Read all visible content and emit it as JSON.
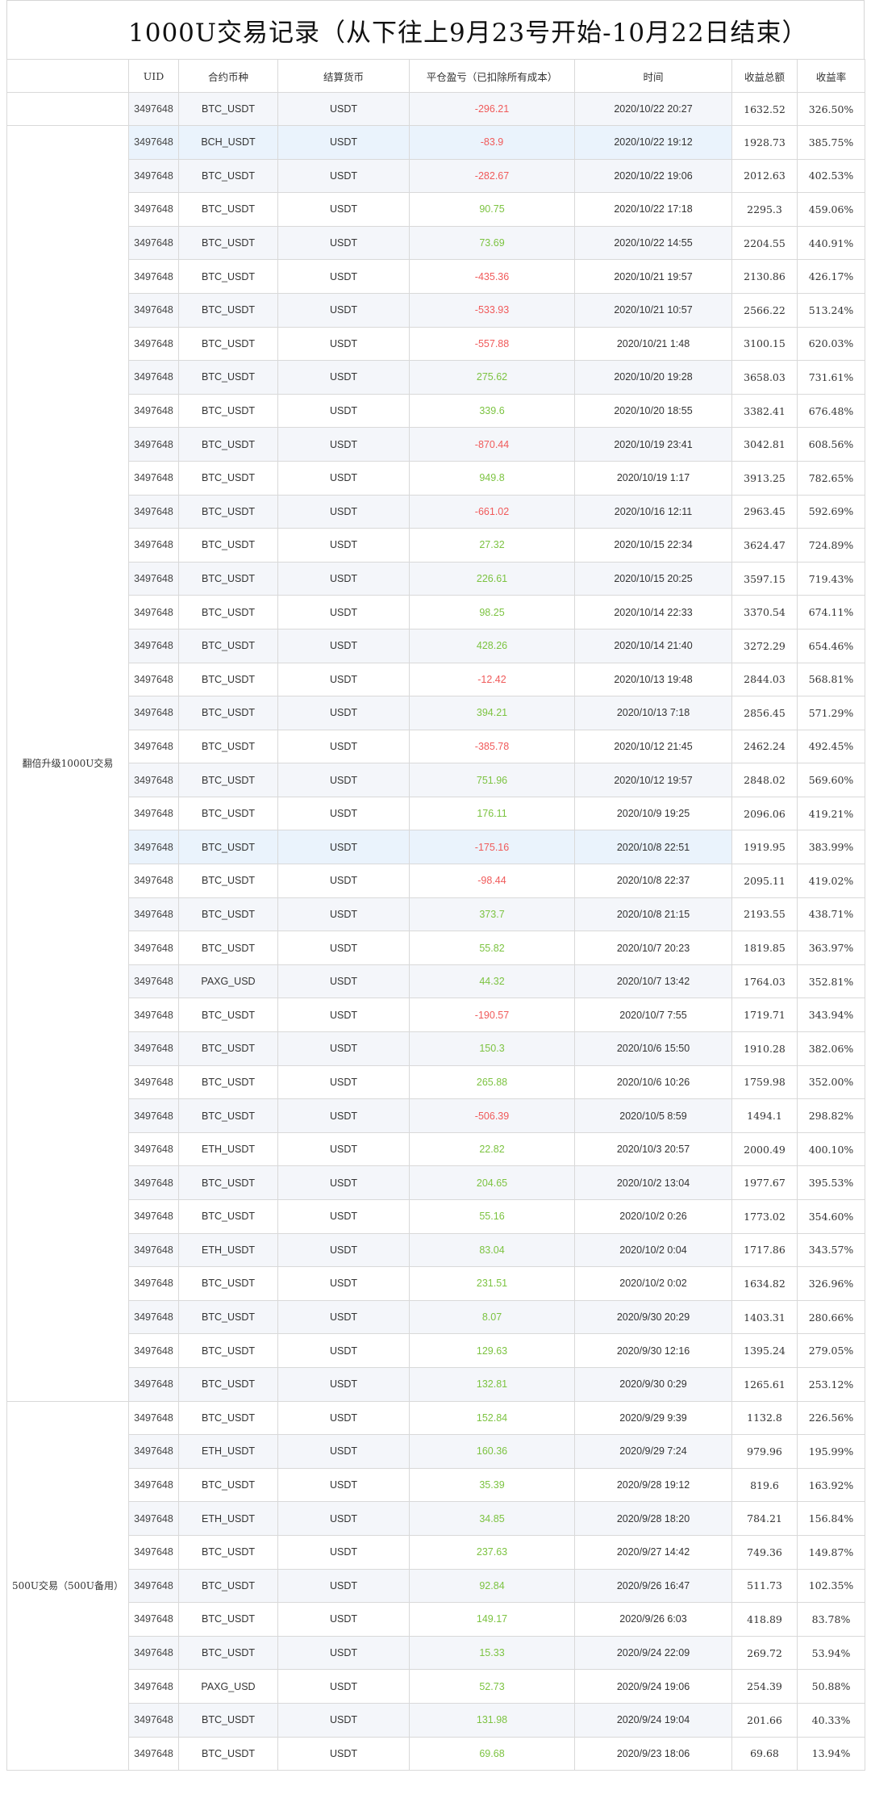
{
  "title": "1000U交易记录（从下往上9月23号开始-10月22日结束）",
  "headers": {
    "uid": "UID",
    "contract": "合约币种",
    "settle": "结算货币",
    "pnl": "平仓盈亏（已扣除所有成本）",
    "time": "时间",
    "total": "收益总额",
    "rate": "收益率"
  },
  "groups": [
    {
      "label": "",
      "rows": 1
    },
    {
      "label": "翻倍升级1000U交易",
      "rows": 38
    },
    {
      "label": "500U交易（500U备用）",
      "rows": 11
    }
  ],
  "colors": {
    "negative": "#f05a5a",
    "positive": "#7cc341",
    "stripe": "#f4f6fa",
    "highlight": "#eaf3fc"
  },
  "rows": [
    {
      "uid": "3497648",
      "contract": "BTC_USDT",
      "settle": "USDT",
      "pnl": "-296.21",
      "time": "2020/10/22 20:27",
      "total": "1632.52",
      "rate": "326.50%",
      "neg": true
    },
    {
      "uid": "3497648",
      "contract": "BCH_USDT",
      "settle": "USDT",
      "pnl": "-83.9",
      "time": "2020/10/22 19:12",
      "total": "1928.73",
      "rate": "385.75%",
      "neg": true,
      "hl": true
    },
    {
      "uid": "3497648",
      "contract": "BTC_USDT",
      "settle": "USDT",
      "pnl": "-282.67",
      "time": "2020/10/22 19:06",
      "total": "2012.63",
      "rate": "402.53%",
      "neg": true
    },
    {
      "uid": "3497648",
      "contract": "BTC_USDT",
      "settle": "USDT",
      "pnl": "90.75",
      "time": "2020/10/22 17:18",
      "total": "2295.3",
      "rate": "459.06%"
    },
    {
      "uid": "3497648",
      "contract": "BTC_USDT",
      "settle": "USDT",
      "pnl": "73.69",
      "time": "2020/10/22 14:55",
      "total": "2204.55",
      "rate": "440.91%"
    },
    {
      "uid": "3497648",
      "contract": "BTC_USDT",
      "settle": "USDT",
      "pnl": "-435.36",
      "time": "2020/10/21 19:57",
      "total": "2130.86",
      "rate": "426.17%",
      "neg": true
    },
    {
      "uid": "3497648",
      "contract": "BTC_USDT",
      "settle": "USDT",
      "pnl": "-533.93",
      "time": "2020/10/21 10:57",
      "total": "2566.22",
      "rate": "513.24%",
      "neg": true
    },
    {
      "uid": "3497648",
      "contract": "BTC_USDT",
      "settle": "USDT",
      "pnl": "-557.88",
      "time": "2020/10/21 1:48",
      "total": "3100.15",
      "rate": "620.03%",
      "neg": true
    },
    {
      "uid": "3497648",
      "contract": "BTC_USDT",
      "settle": "USDT",
      "pnl": "275.62",
      "time": "2020/10/20 19:28",
      "total": "3658.03",
      "rate": "731.61%"
    },
    {
      "uid": "3497648",
      "contract": "BTC_USDT",
      "settle": "USDT",
      "pnl": "339.6",
      "time": "2020/10/20 18:55",
      "total": "3382.41",
      "rate": "676.48%"
    },
    {
      "uid": "3497648",
      "contract": "BTC_USDT",
      "settle": "USDT",
      "pnl": "-870.44",
      "time": "2020/10/19 23:41",
      "total": "3042.81",
      "rate": "608.56%",
      "neg": true
    },
    {
      "uid": "3497648",
      "contract": "BTC_USDT",
      "settle": "USDT",
      "pnl": "949.8",
      "time": "2020/10/19 1:17",
      "total": "3913.25",
      "rate": "782.65%"
    },
    {
      "uid": "3497648",
      "contract": "BTC_USDT",
      "settle": "USDT",
      "pnl": "-661.02",
      "time": "2020/10/16 12:11",
      "total": "2963.45",
      "rate": "592.69%",
      "neg": true
    },
    {
      "uid": "3497648",
      "contract": "BTC_USDT",
      "settle": "USDT",
      "pnl": "27.32",
      "time": "2020/10/15 22:34",
      "total": "3624.47",
      "rate": "724.89%"
    },
    {
      "uid": "3497648",
      "contract": "BTC_USDT",
      "settle": "USDT",
      "pnl": "226.61",
      "time": "2020/10/15 20:25",
      "total": "3597.15",
      "rate": "719.43%"
    },
    {
      "uid": "3497648",
      "contract": "BTC_USDT",
      "settle": "USDT",
      "pnl": "98.25",
      "time": "2020/10/14 22:33",
      "total": "3370.54",
      "rate": "674.11%"
    },
    {
      "uid": "3497648",
      "contract": "BTC_USDT",
      "settle": "USDT",
      "pnl": "428.26",
      "time": "2020/10/14 21:40",
      "total": "3272.29",
      "rate": "654.46%"
    },
    {
      "uid": "3497648",
      "contract": "BTC_USDT",
      "settle": "USDT",
      "pnl": "-12.42",
      "time": "2020/10/13 19:48",
      "total": "2844.03",
      "rate": "568.81%",
      "neg": true
    },
    {
      "uid": "3497648",
      "contract": "BTC_USDT",
      "settle": "USDT",
      "pnl": "394.21",
      "time": "2020/10/13 7:18",
      "total": "2856.45",
      "rate": "571.29%"
    },
    {
      "uid": "3497648",
      "contract": "BTC_USDT",
      "settle": "USDT",
      "pnl": "-385.78",
      "time": "2020/10/12 21:45",
      "total": "2462.24",
      "rate": "492.45%",
      "neg": true
    },
    {
      "uid": "3497648",
      "contract": "BTC_USDT",
      "settle": "USDT",
      "pnl": "751.96",
      "time": "2020/10/12 19:57",
      "total": "2848.02",
      "rate": "569.60%"
    },
    {
      "uid": "3497648",
      "contract": "BTC_USDT",
      "settle": "USDT",
      "pnl": "176.11",
      "time": "2020/10/9 19:25",
      "total": "2096.06",
      "rate": "419.21%"
    },
    {
      "uid": "3497648",
      "contract": "BTC_USDT",
      "settle": "USDT",
      "pnl": "-175.16",
      "time": "2020/10/8 22:51",
      "total": "1919.95",
      "rate": "383.99%",
      "neg": true,
      "hl": true
    },
    {
      "uid": "3497648",
      "contract": "BTC_USDT",
      "settle": "USDT",
      "pnl": "-98.44",
      "time": "2020/10/8 22:37",
      "total": "2095.11",
      "rate": "419.02%",
      "neg": true
    },
    {
      "uid": "3497648",
      "contract": "BTC_USDT",
      "settle": "USDT",
      "pnl": "373.7",
      "time": "2020/10/8 21:15",
      "total": "2193.55",
      "rate": "438.71%"
    },
    {
      "uid": "3497648",
      "contract": "BTC_USDT",
      "settle": "USDT",
      "pnl": "55.82",
      "time": "2020/10/7 20:23",
      "total": "1819.85",
      "rate": "363.97%"
    },
    {
      "uid": "3497648",
      "contract": "PAXG_USD",
      "settle": "USDT",
      "pnl": "44.32",
      "time": "2020/10/7 13:42",
      "total": "1764.03",
      "rate": "352.81%"
    },
    {
      "uid": "3497648",
      "contract": "BTC_USDT",
      "settle": "USDT",
      "pnl": "-190.57",
      "time": "2020/10/7 7:55",
      "total": "1719.71",
      "rate": "343.94%",
      "neg": true
    },
    {
      "uid": "3497648",
      "contract": "BTC_USDT",
      "settle": "USDT",
      "pnl": "150.3",
      "time": "2020/10/6 15:50",
      "total": "1910.28",
      "rate": "382.06%"
    },
    {
      "uid": "3497648",
      "contract": "BTC_USDT",
      "settle": "USDT",
      "pnl": "265.88",
      "time": "2020/10/6 10:26",
      "total": "1759.98",
      "rate": "352.00%"
    },
    {
      "uid": "3497648",
      "contract": "BTC_USDT",
      "settle": "USDT",
      "pnl": "-506.39",
      "time": "2020/10/5 8:59",
      "total": "1494.1",
      "rate": "298.82%",
      "neg": true
    },
    {
      "uid": "3497648",
      "contract": "ETH_USDT",
      "settle": "USDT",
      "pnl": "22.82",
      "time": "2020/10/3 20:57",
      "total": "2000.49",
      "rate": "400.10%"
    },
    {
      "uid": "3497648",
      "contract": "BTC_USDT",
      "settle": "USDT",
      "pnl": "204.65",
      "time": "2020/10/2 13:04",
      "total": "1977.67",
      "rate": "395.53%"
    },
    {
      "uid": "3497648",
      "contract": "BTC_USDT",
      "settle": "USDT",
      "pnl": "55.16",
      "time": "2020/10/2 0:26",
      "total": "1773.02",
      "rate": "354.60%"
    },
    {
      "uid": "3497648",
      "contract": "ETH_USDT",
      "settle": "USDT",
      "pnl": "83.04",
      "time": "2020/10/2 0:04",
      "total": "1717.86",
      "rate": "343.57%"
    },
    {
      "uid": "3497648",
      "contract": "BTC_USDT",
      "settle": "USDT",
      "pnl": "231.51",
      "time": "2020/10/2 0:02",
      "total": "1634.82",
      "rate": "326.96%"
    },
    {
      "uid": "3497648",
      "contract": "BTC_USDT",
      "settle": "USDT",
      "pnl": "8.07",
      "time": "2020/9/30 20:29",
      "total": "1403.31",
      "rate": "280.66%"
    },
    {
      "uid": "3497648",
      "contract": "BTC_USDT",
      "settle": "USDT",
      "pnl": "129.63",
      "time": "2020/9/30 12:16",
      "total": "1395.24",
      "rate": "279.05%"
    },
    {
      "uid": "3497648",
      "contract": "BTC_USDT",
      "settle": "USDT",
      "pnl": "132.81",
      "time": "2020/9/30 0:29",
      "total": "1265.61",
      "rate": "253.12%"
    },
    {
      "uid": "3497648",
      "contract": "BTC_USDT",
      "settle": "USDT",
      "pnl": "152.84",
      "time": "2020/9/29 9:39",
      "total": "1132.8",
      "rate": "226.56%"
    },
    {
      "uid": "3497648",
      "contract": "ETH_USDT",
      "settle": "USDT",
      "pnl": "160.36",
      "time": "2020/9/29 7:24",
      "total": "979.96",
      "rate": "195.99%"
    },
    {
      "uid": "3497648",
      "contract": "BTC_USDT",
      "settle": "USDT",
      "pnl": "35.39",
      "time": "2020/9/28 19:12",
      "total": "819.6",
      "rate": "163.92%"
    },
    {
      "uid": "3497648",
      "contract": "ETH_USDT",
      "settle": "USDT",
      "pnl": "34.85",
      "time": "2020/9/28 18:20",
      "total": "784.21",
      "rate": "156.84%"
    },
    {
      "uid": "3497648",
      "contract": "BTC_USDT",
      "settle": "USDT",
      "pnl": "237.63",
      "time": "2020/9/27 14:42",
      "total": "749.36",
      "rate": "149.87%"
    },
    {
      "uid": "3497648",
      "contract": "BTC_USDT",
      "settle": "USDT",
      "pnl": "92.84",
      "time": "2020/9/26 16:47",
      "total": "511.73",
      "rate": "102.35%"
    },
    {
      "uid": "3497648",
      "contract": "BTC_USDT",
      "settle": "USDT",
      "pnl": "149.17",
      "time": "2020/9/26 6:03",
      "total": "418.89",
      "rate": "83.78%"
    },
    {
      "uid": "3497648",
      "contract": "BTC_USDT",
      "settle": "USDT",
      "pnl": "15.33",
      "time": "2020/9/24 22:09",
      "total": "269.72",
      "rate": "53.94%"
    },
    {
      "uid": "3497648",
      "contract": "PAXG_USD",
      "settle": "USDT",
      "pnl": "52.73",
      "time": "2020/9/24 19:06",
      "total": "254.39",
      "rate": "50.88%"
    },
    {
      "uid": "3497648",
      "contract": "BTC_USDT",
      "settle": "USDT",
      "pnl": "131.98",
      "time": "2020/9/24 19:04",
      "total": "201.66",
      "rate": "40.33%"
    },
    {
      "uid": "3497648",
      "contract": "BTC_USDT",
      "settle": "USDT",
      "pnl": "69.68",
      "time": "2020/9/23 18:06",
      "total": "69.68",
      "rate": "13.94%"
    }
  ]
}
